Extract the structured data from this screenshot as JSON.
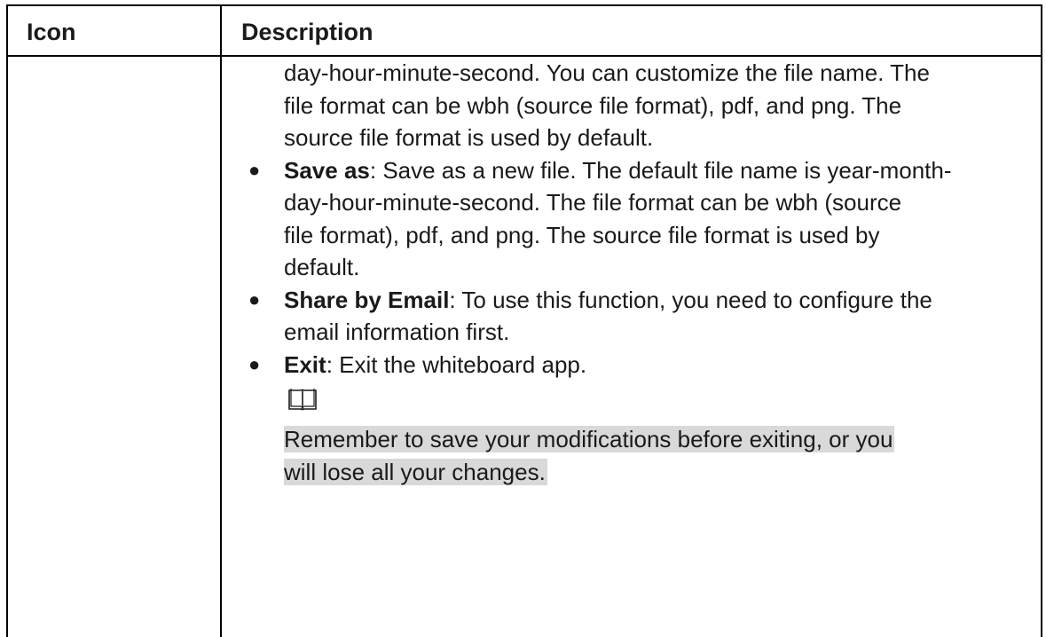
{
  "table": {
    "headers": {
      "icon": "Icon",
      "description": "Description"
    },
    "intro_lines": [
      "day-hour-minute-second. You can customize the file name. The",
      "file format can be wbh (source file format), pdf, and png. The",
      "source file format is used by default."
    ],
    "bullets": [
      {
        "term": "Save as",
        "lines": [
          ": Save as a new file. The default file name is year-month-",
          "day-hour-minute-second. The file format can be wbh (source",
          "file format), pdf, and png. The source file format is used by",
          "default."
        ]
      },
      {
        "term": "Share by Email",
        "lines": [
          ": To use this function, you need to configure the",
          "email information first."
        ]
      },
      {
        "term": "Exit",
        "lines": [
          ": Exit the whiteboard app."
        ]
      }
    ],
    "note": {
      "icon": "book-icon",
      "lines": [
        "Remember to save your modifications before exiting, or you",
        "will lose all your changes."
      ]
    }
  },
  "colors": {
    "text": "#1a1a1a",
    "border": "#000000",
    "note_highlight": "#d9d9d9"
  }
}
